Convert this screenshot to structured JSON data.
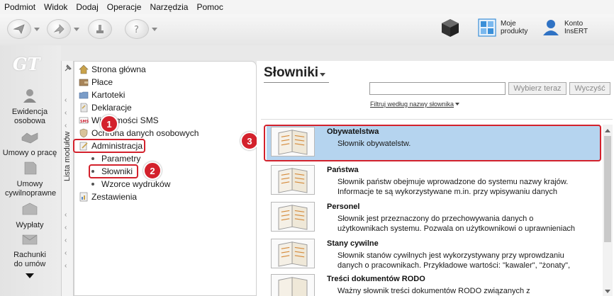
{
  "menu": [
    "Podmiot",
    "Widok",
    "Dodaj",
    "Operacje",
    "Narzędzia",
    "Pomoc"
  ],
  "toolbar": {
    "moje_produkty": [
      "Moje",
      "produkty"
    ],
    "konto": [
      "Konto",
      "InsERT"
    ],
    "konto_icon_label": "InsERT"
  },
  "leftpanel": {
    "logo": "GT",
    "items": [
      {
        "label": "Ewidencja osobowa"
      },
      {
        "label": "Umowy o pracę"
      },
      {
        "label": "Umowy cywilnoprawne"
      },
      {
        "label": "Wypłaty"
      },
      {
        "label": "Rachunki do umów"
      }
    ]
  },
  "modstrip": {
    "label": "Lista modułów"
  },
  "tree": {
    "items": [
      {
        "label": "Strona główna"
      },
      {
        "label": "Płace"
      },
      {
        "label": "Kartoteki"
      },
      {
        "label": "Deklaracje"
      },
      {
        "label": "Wiadomości SMS"
      },
      {
        "label": "Ochrona danych osobowych"
      },
      {
        "label": "Administracja"
      }
    ],
    "subitems": [
      {
        "label": "Parametry"
      },
      {
        "label": "Słowniki"
      },
      {
        "label": "Wzorce wydruków"
      }
    ],
    "last": {
      "label": "Zestawienia"
    }
  },
  "badges": [
    "1",
    "2",
    "3"
  ],
  "main": {
    "title": "Słowniki",
    "search_value": "",
    "search_button": "Wybierz teraz",
    "clear_button": "Wyczyść",
    "filter_link": "Filtruj według nazwy słownika",
    "rows": [
      {
        "name": "Obywatelstwa",
        "desc": [
          "Słownik obywatelstw."
        ],
        "selected": true
      },
      {
        "name": "Państwa",
        "desc": [
          "Słownik państw obejmuje wprowadzone do systemu nazwy krajów.",
          "Informacje te są wykorzystywane m.in. przy wpisywaniu danych"
        ],
        "selected": false
      },
      {
        "name": "Personel",
        "desc": [
          "Słownik jest przeznaczony do przechowywania danych o",
          "użytkownikach systemu. Pozwala on użytkownikowi o uprawnieniach"
        ],
        "selected": false
      },
      {
        "name": "Stany cywilne",
        "desc": [
          "Słownik stanów cywilnych jest wykorzystywany przy wprowdzaniu",
          "danych o pracownikach. Przykładowe wartości: \"kawaler\", \"żonaty\","
        ],
        "selected": false
      },
      {
        "name": "Treści dokumentów RODO",
        "desc": [
          "Ważny słownik treści dokumentów RODO związanych z"
        ],
        "selected": false
      }
    ]
  },
  "colors": {
    "accent_red": "#d3212c",
    "selected_row": "#b5d4ef"
  }
}
